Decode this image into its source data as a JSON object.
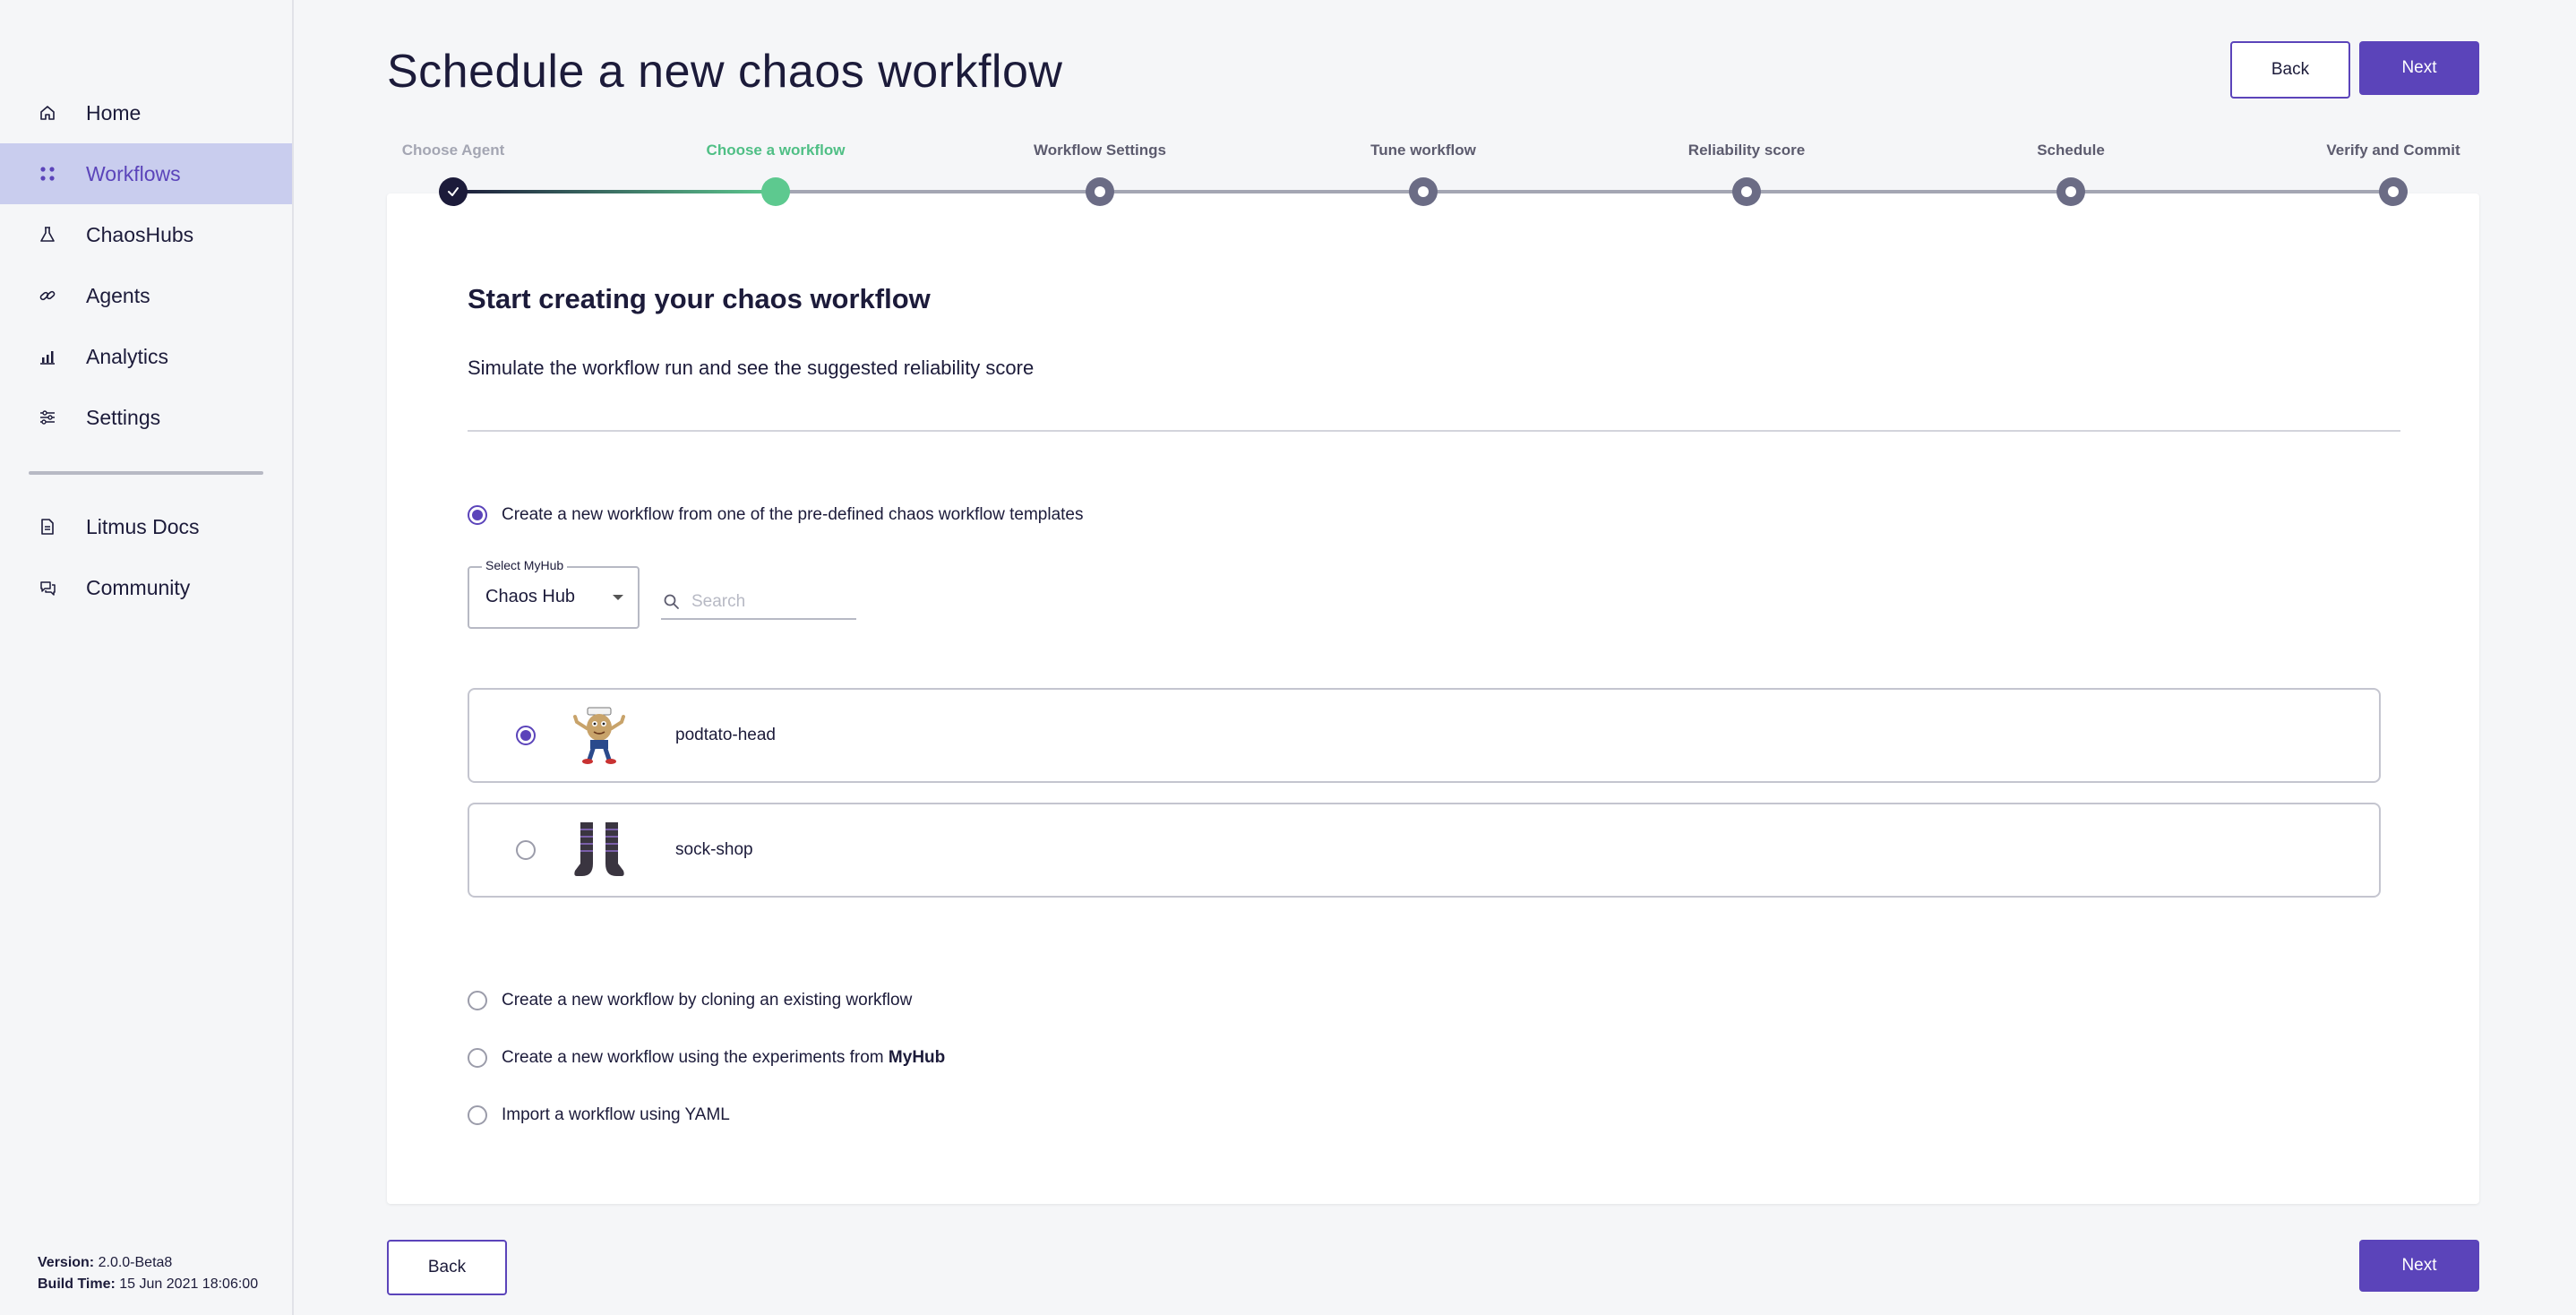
{
  "sidebar": {
    "items": [
      {
        "label": "Home",
        "icon": "home-icon"
      },
      {
        "label": "Workflows",
        "icon": "workflows-icon"
      },
      {
        "label": "ChaosHubs",
        "icon": "flask-icon"
      },
      {
        "label": "Agents",
        "icon": "link-icon"
      },
      {
        "label": "Analytics",
        "icon": "analytics-icon"
      },
      {
        "label": "Settings",
        "icon": "sliders-icon"
      }
    ],
    "secondary_items": [
      {
        "label": "Litmus Docs",
        "icon": "document-icon"
      },
      {
        "label": "Community",
        "icon": "chat-icon"
      }
    ],
    "version_label": "Version:",
    "version_value": "2.0.0-Beta8",
    "build_label": "Build Time:",
    "build_value": "15 Jun 2021 18:06:00"
  },
  "header": {
    "title": "Schedule a new chaos workflow",
    "back_label": "Back",
    "next_label": "Next"
  },
  "stepper": {
    "steps": [
      {
        "label": "Choose Agent",
        "state": "done"
      },
      {
        "label": "Choose a workflow",
        "state": "current"
      },
      {
        "label": "Workflow Settings",
        "state": "pending"
      },
      {
        "label": "Tune workflow",
        "state": "pending"
      },
      {
        "label": "Reliability score",
        "state": "pending"
      },
      {
        "label": "Schedule",
        "state": "pending"
      },
      {
        "label": "Verify and Commit",
        "state": "pending"
      }
    ]
  },
  "card": {
    "title": "Start creating your chaos workflow",
    "subtitle": "Simulate the workflow run and see the suggested reliability score",
    "option_templates": "Create a new workflow from one of the pre-defined chaos workflow templates",
    "select_legend": "Select MyHub",
    "select_value": "Chaos Hub",
    "search_placeholder": "Search",
    "hubs": [
      {
        "name": "podtato-head",
        "selected": true
      },
      {
        "name": "sock-shop",
        "selected": false
      }
    ],
    "option_clone": "Create a new workflow by cloning an existing workflow",
    "option_myhub_prefix": "Create a new workflow using the experiments from ",
    "option_myhub_bold": "MyHub",
    "option_yaml": "Import a workflow using YAML"
  },
  "footer": {
    "back_label": "Back",
    "next_label": "Next"
  },
  "colors": {
    "accent": "#5b44ba",
    "active_nav_bg": "#c9cdee",
    "current_step": "#5dc98f",
    "done_step": "#1c1b3a",
    "pending_step": "#6b6c85"
  }
}
